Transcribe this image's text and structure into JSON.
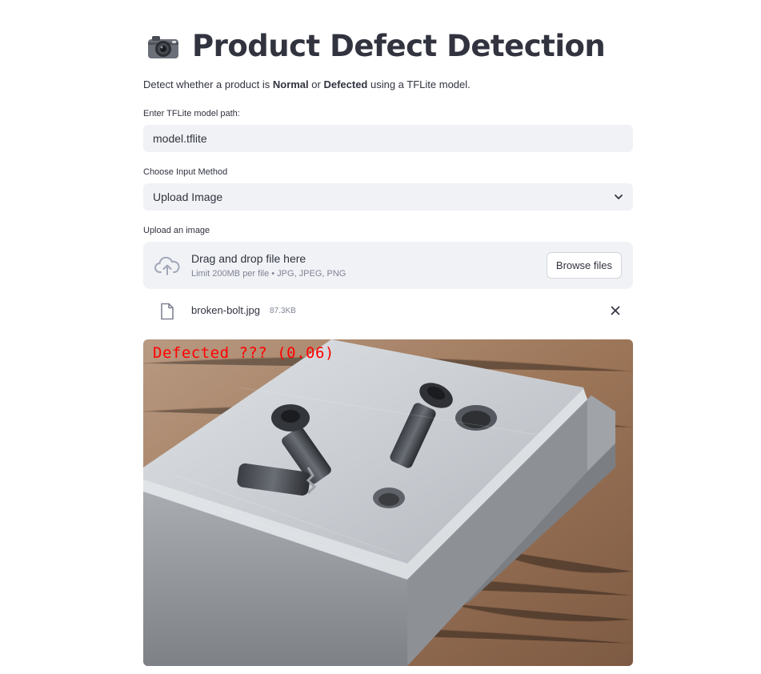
{
  "header": {
    "icon": "camera-icon",
    "title": "Product Defect Detection"
  },
  "description": {
    "prefix": "Detect whether a product is ",
    "normal": "Normal",
    "middle": " or ",
    "defected": "Defected",
    "suffix": " using a TFLite model."
  },
  "model_path": {
    "label": "Enter TFLite model path:",
    "value": "model.tflite"
  },
  "input_method": {
    "label": "Choose Input Method",
    "selected": "Upload Image"
  },
  "uploader": {
    "label": "Upload an image",
    "drop_text": "Drag and drop file here",
    "limit_text": "Limit 200MB per file • JPG, JPEG, PNG",
    "browse_label": "Browse files",
    "file": {
      "name": "broken-bolt.jpg",
      "size": "87.3KB"
    }
  },
  "result": {
    "overlay_text": "Defected ??? (0.06)",
    "overlay_color": "#ff0000"
  },
  "colors": {
    "text": "#31333f",
    "field_bg": "#f0f2f6",
    "muted": "#808495"
  }
}
